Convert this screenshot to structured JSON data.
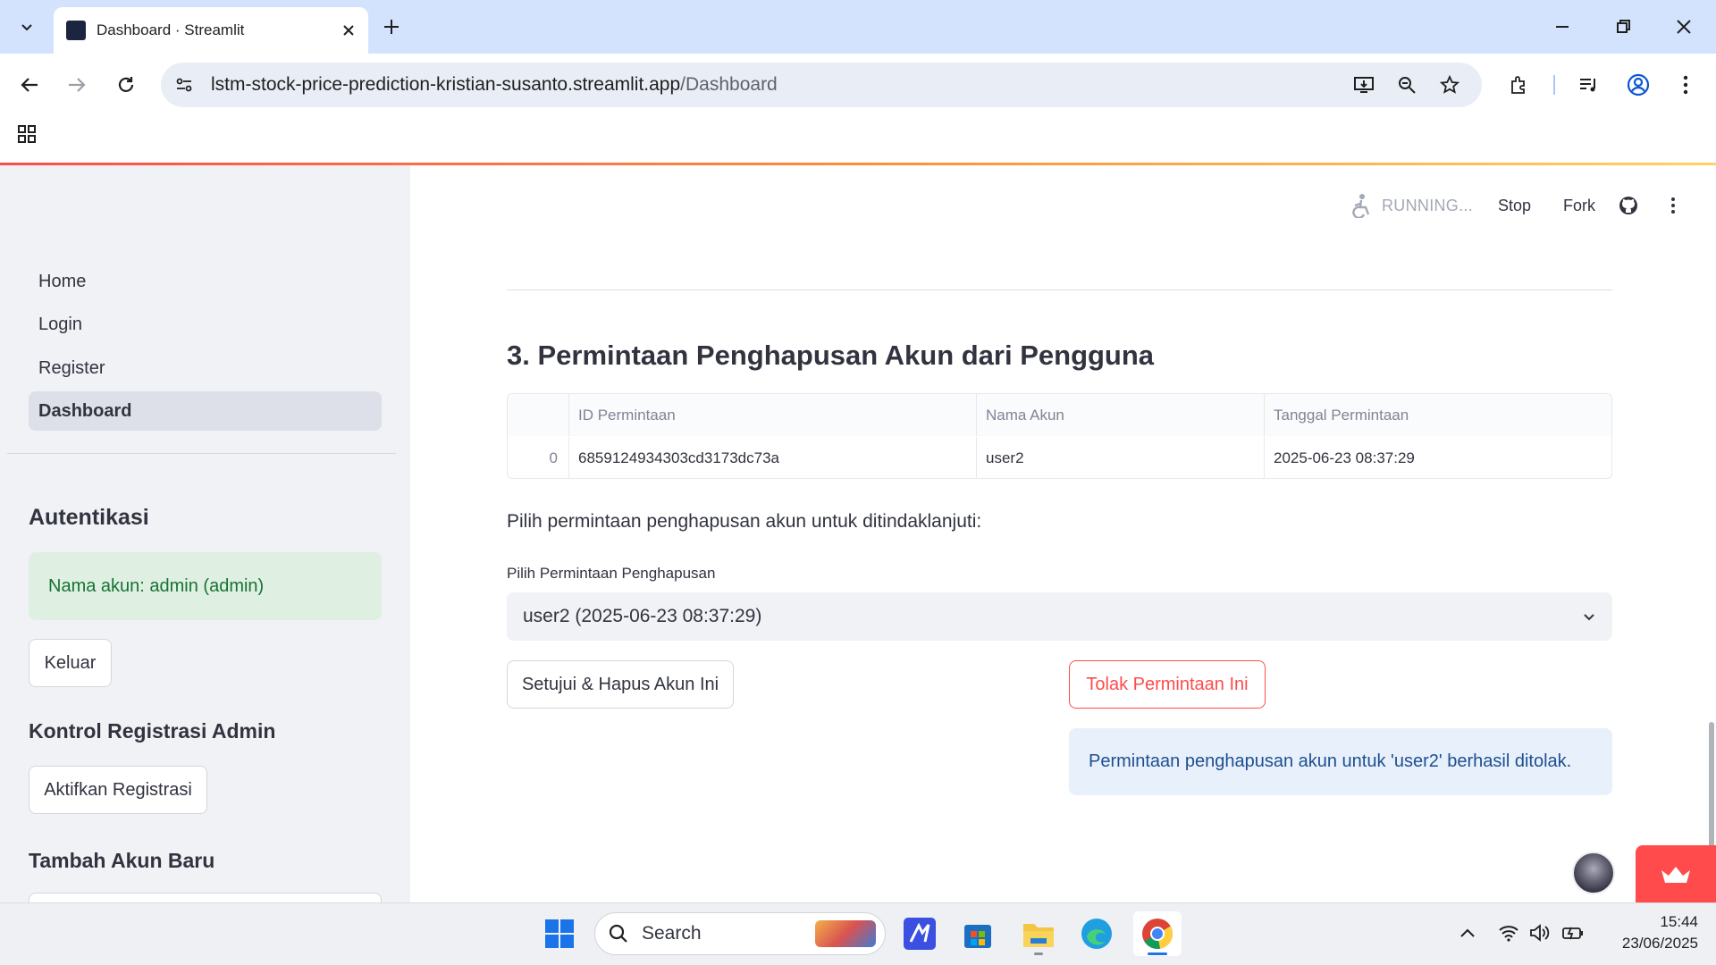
{
  "browser": {
    "tab_title": "Dashboard · Streamlit",
    "url_host": "lstm-stock-price-prediction-kristian-susanto.streamlit.app",
    "url_path": "/Dashboard"
  },
  "sidebar": {
    "nav": [
      {
        "label": "Home",
        "active": false
      },
      {
        "label": "Login",
        "active": false
      },
      {
        "label": "Register",
        "active": false
      },
      {
        "label": "Dashboard",
        "active": true
      }
    ],
    "auth_heading": "Autentikasi",
    "auth_status": "Nama akun: admin (admin)",
    "logout_label": "Keluar",
    "reg_heading": "Kontrol Registrasi Admin",
    "reg_button": "Aktifkan Registrasi",
    "add_heading": "Tambah Akun Baru"
  },
  "toolbar": {
    "status": "RUNNING...",
    "stop": "Stop",
    "fork": "Fork"
  },
  "main": {
    "section_title": "3. Permintaan Penghapusan Akun dari Pengguna",
    "table": {
      "columns": [
        "",
        "ID Permintaan",
        "Nama Akun",
        "Tanggal Permintaan"
      ],
      "rows": [
        [
          "0",
          "6859124934303cd3173dc73a",
          "user2",
          "2025-06-23 08:37:29"
        ]
      ]
    },
    "prompt": "Pilih permintaan penghapusan akun untuk ditindaklanjuti:",
    "select_label": "Pilih Permintaan Penghapusan",
    "select_value": "user2 (2025-06-23 08:37:29)",
    "approve_label": "Setujui & Hapus Akun Ini",
    "reject_label": "Tolak Permintaan Ini",
    "info_message": "Permintaan penghapusan akun untuk 'user2' berhasil ditolak."
  },
  "taskbar": {
    "search_placeholder": "Search",
    "time": "15:44",
    "date": "23/06/2025"
  },
  "colors": {
    "accent": "#ff4b4b",
    "sidebar_bg": "#f0f2f6",
    "success_bg": "#dff0e3",
    "info_bg": "#e8f0fb"
  }
}
